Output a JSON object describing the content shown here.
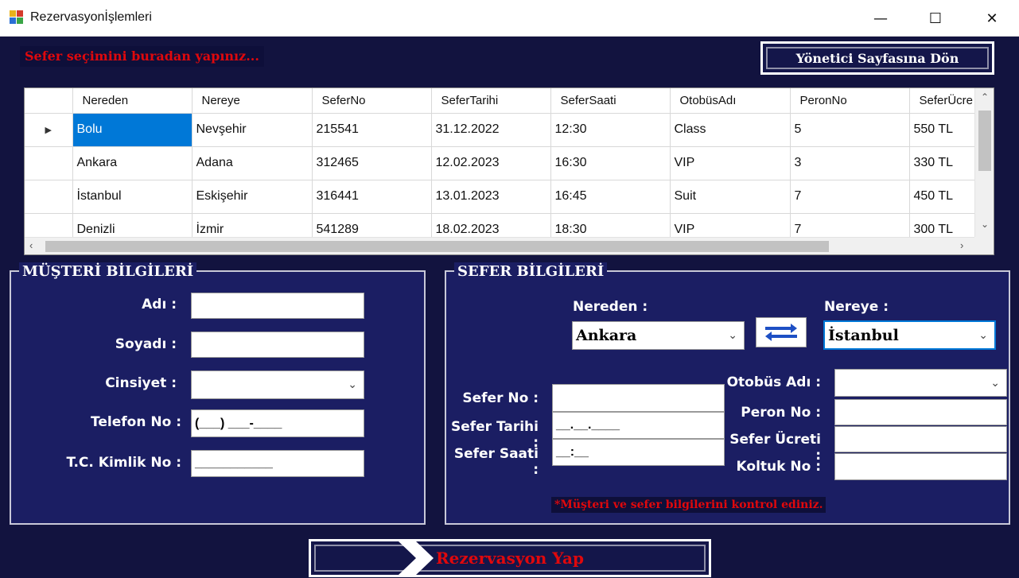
{
  "window": {
    "title": "Rezervasyonİşlemleri",
    "minimize": "—",
    "maximize": "☐",
    "close": "✕"
  },
  "header": {
    "hint": "Sefer seçimini buradan yapınız...",
    "admin_button": "Yönetici Sayfasına Dön"
  },
  "grid": {
    "columns": [
      "Nereden",
      "Nereye",
      "SeferNo",
      "SeferTarihi",
      "SeferSaati",
      "OtobüsAdı",
      "PeronNo",
      "SeferÜcre"
    ],
    "rows": [
      [
        "Bolu",
        "Nevşehir",
        "215541",
        "31.12.2022",
        "12:30",
        "Class",
        "5",
        "550 TL"
      ],
      [
        "Ankara",
        "Adana",
        "312465",
        "12.02.2023",
        "16:30",
        "VIP",
        "3",
        "330 TL"
      ],
      [
        "İstanbul",
        "Eskişehir",
        "316441",
        "13.01.2023",
        "16:45",
        "Suit",
        "7",
        "450 TL"
      ],
      [
        "Denizli",
        "İzmir",
        "541289",
        "18.02.2023",
        "18:30",
        "VIP",
        "7",
        "300 TL"
      ]
    ],
    "current_row_marker": "▶",
    "selected_row": 0
  },
  "customer": {
    "legend": "MÜŞTERİ BİLGİLERİ",
    "name_label": "Adı :",
    "surname_label": "Soyadı :",
    "gender_label": "Cinsiyet :",
    "phone_label": "Telefon No :",
    "phone_mask": "(___) ___-____",
    "tc_label": "T.C. Kimlik No :",
    "tc_mask": "___________"
  },
  "trip": {
    "legend": "SEFER BİLGİLERİ",
    "from_label": "Nereden :",
    "from_value": "Ankara",
    "to_label": "Nereye :",
    "to_value": "İstanbul",
    "no_label": "Sefer No :",
    "date_label": "Sefer Tarihi :",
    "date_mask": "__.__.____",
    "time_label": "Sefer Saati :",
    "time_mask": "__:__",
    "bus_label": "Otobüs Adı :",
    "platform_label": "Peron No :",
    "price_label": "Sefer Ücreti :",
    "seat_label": "Koltuk No :",
    "note": "*Müşteri ve sefer bilgilerini kontrol ediniz."
  },
  "actions": {
    "reserve_button": "Rezervasyon Yap"
  },
  "colors": {
    "background": "#12133f",
    "panel": "#1b1e63",
    "accent_red": "#e0080c",
    "selection": "#0078d7"
  }
}
